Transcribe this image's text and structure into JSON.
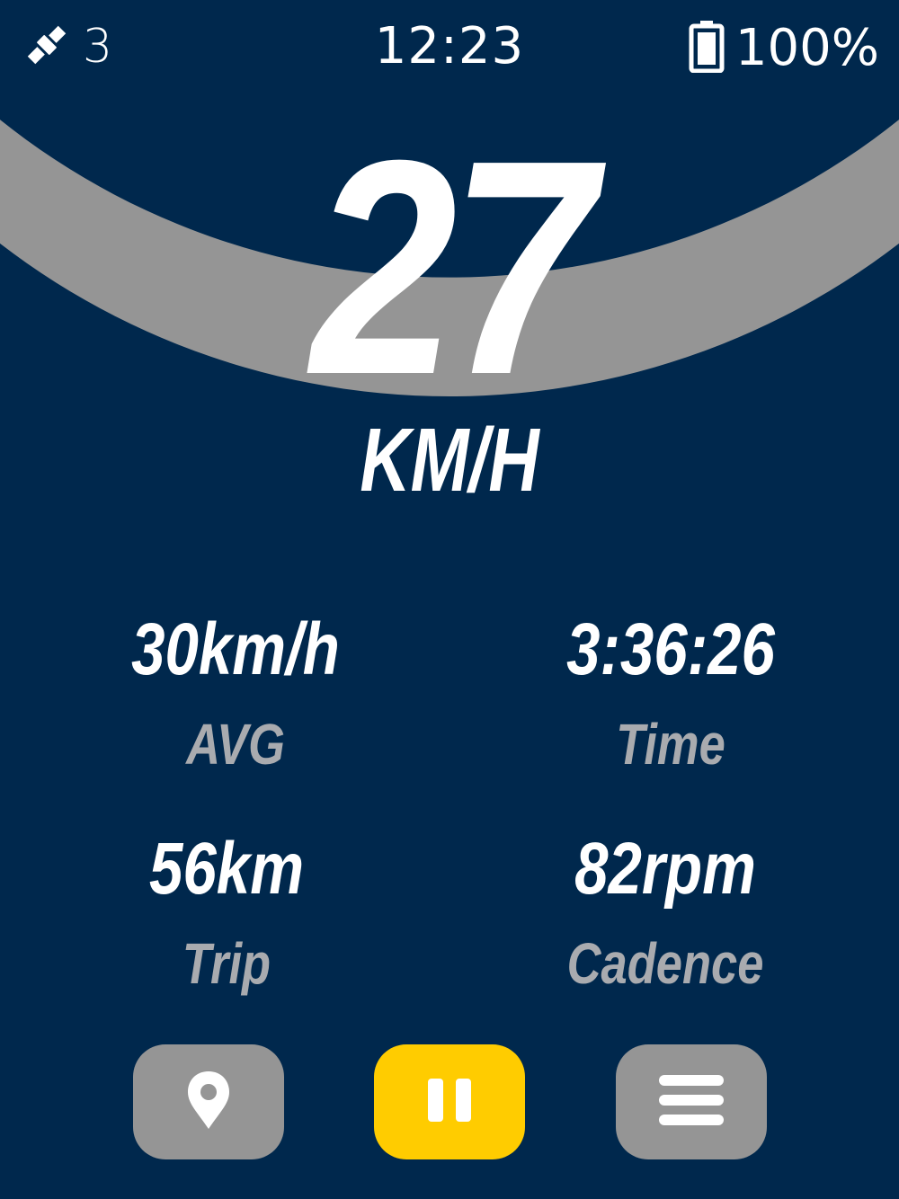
{
  "status": {
    "satellite_icon": "satellite-icon",
    "satellite_count": "3",
    "time": "12:23",
    "battery_icon": "battery-full-icon",
    "battery_percent": "100%"
  },
  "speed": {
    "value": "27",
    "unit": "KM/H",
    "gauge_color": "#959595"
  },
  "metrics": [
    {
      "value": "30km/h",
      "label": "AVG"
    },
    {
      "value": "3:36:26",
      "label": "Time"
    },
    {
      "value": "56km",
      "label": "Trip"
    },
    {
      "value": "82rpm",
      "label": "Cadence"
    }
  ],
  "controls": {
    "location": {
      "icon": "map-pin-icon",
      "color": "#959595"
    },
    "pause": {
      "icon": "pause-icon",
      "color": "#FFCC00"
    },
    "menu": {
      "icon": "hamburger-menu-icon",
      "color": "#959595"
    }
  },
  "colors": {
    "background": "#00284D",
    "primary_text": "#FFFFFF",
    "secondary_text": "#A9ABAF"
  }
}
